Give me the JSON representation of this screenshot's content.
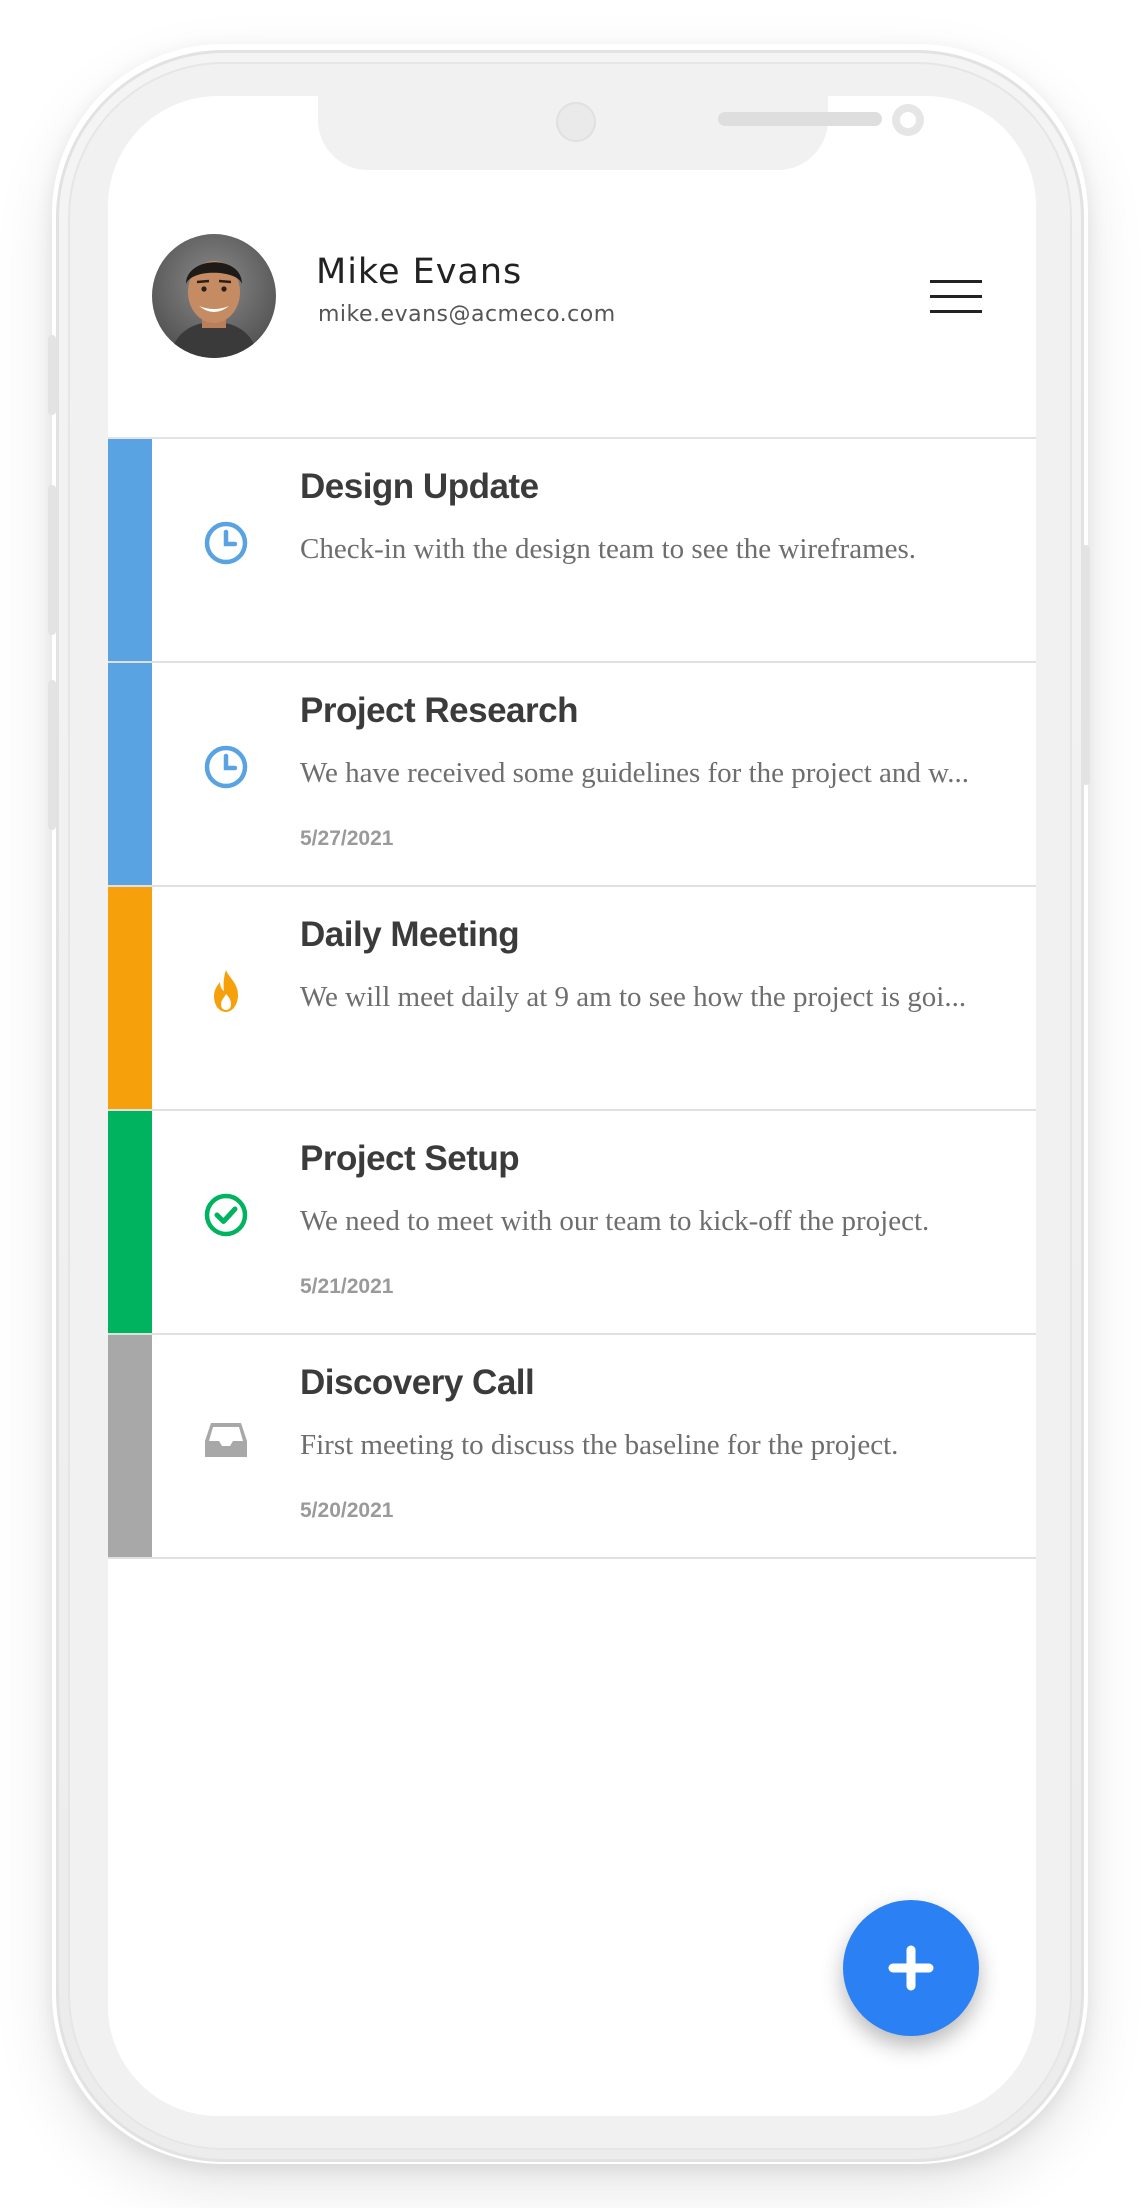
{
  "user": {
    "name": "Mike Evans",
    "email": "mike.evans@acmeco.com",
    "avatar_icon": "avatar-photo"
  },
  "header": {
    "menu_icon": "hamburger-menu-icon"
  },
  "tasks": [
    {
      "title": "Design Update",
      "description": "Check-in with the design team to see the wireframes.",
      "date": "",
      "status_icon": "clock-icon",
      "accent": "#5aa3e2"
    },
    {
      "title": "Project Research",
      "description": "We have received some guidelines for the project and w...",
      "date": "5/27/2021",
      "status_icon": "clock-icon",
      "accent": "#5aa3e2"
    },
    {
      "title": "Daily Meeting",
      "description": "We will meet daily at 9 am to see how the project is goi...",
      "date": "",
      "status_icon": "fire-icon",
      "accent": "#f6a10c"
    },
    {
      "title": "Project Setup",
      "description": "We need to meet with our team to kick-off the project.",
      "date": "5/21/2021",
      "status_icon": "check-circle-icon",
      "accent": "#00b35e"
    },
    {
      "title": "Discovery Call",
      "description": "First meeting to discuss the baseline for the project.",
      "date": "5/20/2021",
      "status_icon": "inbox-icon",
      "accent": "#a8a8a8"
    }
  ],
  "fab": {
    "icon": "plus-icon",
    "color": "#2b80f3"
  }
}
